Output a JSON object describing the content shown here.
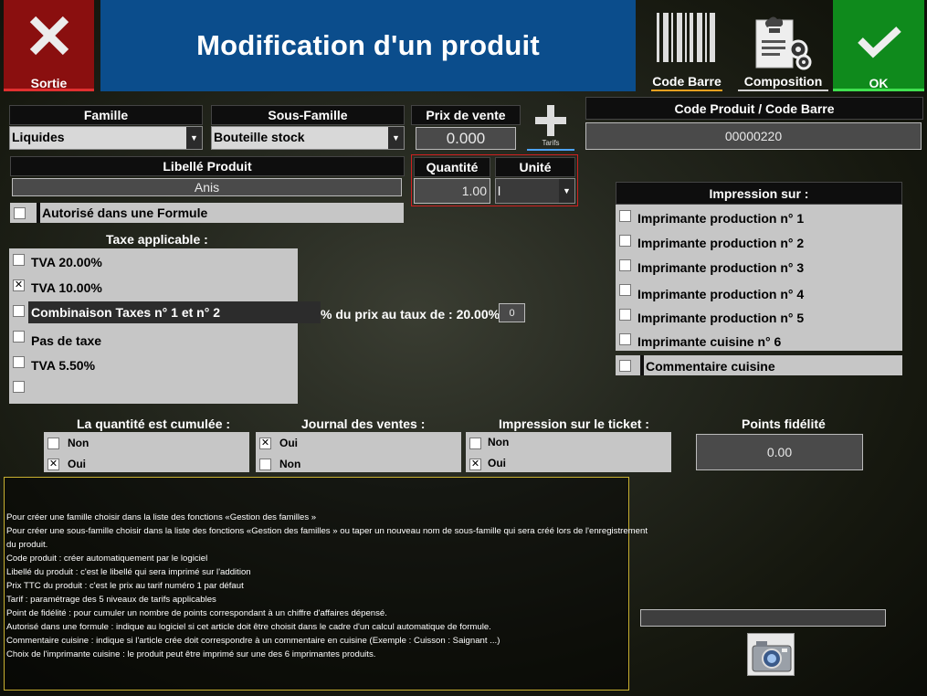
{
  "header": {
    "exit_label": "Sortie",
    "title": "Modification d'un produit",
    "barcode_label": "Code Barre",
    "composition_label": "Composition",
    "ok_label": "OK"
  },
  "famille": {
    "label": "Famille",
    "value": "Liquides"
  },
  "sous_famille": {
    "label": "Sous-Famille",
    "value": "Bouteille stock"
  },
  "prix": {
    "label": "Prix de vente",
    "value": "0.000",
    "tarifs_label": "Tarifs"
  },
  "code_produit": {
    "label": "Code Produit / Code Barre",
    "value": "00000220"
  },
  "libelle": {
    "label": "Libellé Produit",
    "value": "Anis"
  },
  "quantite": {
    "label": "Quantité",
    "value": "1.00"
  },
  "unite": {
    "label": "Unité",
    "value": "l"
  },
  "formule": {
    "label": "Autorisé dans une Formule",
    "checked": false
  },
  "taxe": {
    "label": "Taxe applicable :",
    "options": [
      {
        "label": "TVA 20.00%",
        "checked": false
      },
      {
        "label": "TVA 10.00%",
        "checked": true
      },
      {
        "label": "Combinaison Taxes n° 1 et n° 2",
        "checked": false
      },
      {
        "label": "Pas de taxe",
        "checked": false
      },
      {
        "label": "TVA 5.50%",
        "checked": false
      },
      {
        "label": "",
        "checked": false
      }
    ],
    "pct_label": "% du prix au taux de : 20.00% :",
    "pct_value": "0"
  },
  "impression": {
    "label": "Impression sur :",
    "options": [
      "Imprimante production n° 1",
      "Imprimante production n° 2",
      "Imprimante production n° 3",
      "Imprimante production n° 4",
      "Imprimante production n° 5",
      "Imprimante cuisine n° 6"
    ],
    "commentaire_label": "Commentaire cuisine"
  },
  "cumulee": {
    "label": "La quantité est cumulée :",
    "non": "Non",
    "oui": "Oui",
    "selected": "Oui"
  },
  "journal": {
    "label": "Journal des ventes :",
    "oui": "Oui",
    "non": "Non",
    "selected": "Oui"
  },
  "ticket": {
    "label": "Impression sur le  ticket :",
    "non": "Non",
    "oui": "Oui",
    "selected": "Oui"
  },
  "fidelite": {
    "label": "Points fidélité",
    "value": "0.00"
  },
  "help": {
    "lines": [
      "Pour créer une famille choisir dans la liste des fonctions «Gestion des familles »",
      "Pour créer une sous-famille choisir dans la liste des fonctions «Gestion des familles » ou taper un nouveau nom de sous-famille qui sera créé lors de l'enregistrement",
      "du produit.",
      "Code produit : créer automatiquement par le logiciel",
      "Libellé du produit : c'est le libellé qui sera imprimé sur l'addition",
      "Prix TTC du produit : c'est le prix au tarif numéro 1 par défaut",
      "Tarif : paramétrage des 5 niveaux de tarifs applicables",
      "Point de fidélité : pour cumuler un nombre de points correspondant à un chiffre d'affaires dépensé.",
      "Autorisé dans une formule : indique au logiciel si cet article doit être choisit dans le cadre d'un calcul automatique de formule.",
      "Commentaire cuisine : indique si l'article crée doit correspondre à un commentaire en cuisine (Exemple : Cuisson : Saignant ...)",
      "Choix de l'imprimante cuisine : le produit peut être imprimé sur une des 6 imprimantes produits."
    ]
  },
  "icons": [
    "close-icon",
    "barcode-icon",
    "composition-icon",
    "check-icon",
    "plus-icon",
    "camera-icon"
  ]
}
